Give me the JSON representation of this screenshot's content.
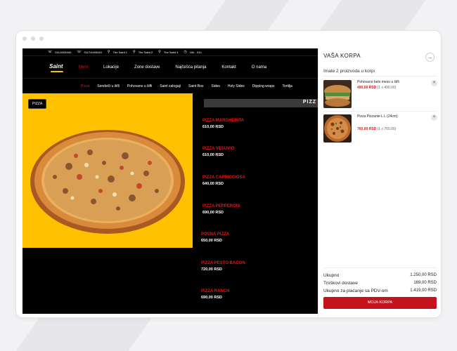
{
  "topbar": {
    "phone1": "011/4405440",
    "phone2": "0117/4405440",
    "loc1": "The Saint 1",
    "loc2": "The Saint 2",
    "loc3": "The Saint 3",
    "hours": "10h - 01h"
  },
  "logo": "Saint",
  "nav": [
    "Meni",
    "Lokacije",
    "Zone dostave",
    "Najčešća pitanja",
    "Kontakt",
    "O nama"
  ],
  "categories": [
    "Pizza",
    "Sendviči u šifli",
    "Pohovano u šifli",
    "Saint zalogaji",
    "Saint Box",
    "Sides",
    "Holy Sides",
    "Dipping wraps",
    "Tortilja"
  ],
  "hero": {
    "tag": "PIZZA"
  },
  "banner": "PIZZ",
  "menu_items": [
    {
      "name": "PIZZA MARGHERITA",
      "price": "610,00 RSD"
    },
    {
      "name": "PIZZA VESUVIO",
      "price": "610,00 RSD"
    },
    {
      "name": "PIZZA CAPRICCIOSA",
      "price": "640,00 RSD"
    },
    {
      "name": "PIZZA PEPPERONI",
      "price": "690,00 RSD"
    },
    {
      "name": "POSNA PIZZA",
      "price": "650,00 RSD"
    },
    {
      "name": "PIZZA PESTO BACON",
      "price": "720,00 RSD"
    },
    {
      "name": "PIZZA RANCH",
      "price": "690,00 RSD"
    }
  ],
  "cart": {
    "title": "VAŠA KORPA",
    "count_text": "Imate 2 proizvoda u korpi",
    "items": [
      {
        "name": "Pohovano belo meso u šifli",
        "price": "490,00 RSD",
        "qty": "(1 x 490,00)"
      },
      {
        "name": "Pizza Pizzante L L (24cm)",
        "price": "760,00 RSD",
        "qty": "(1 x 760,00)"
      }
    ],
    "totals": [
      {
        "label": "Ukupno",
        "value": "1.250,00 RSD"
      },
      {
        "label": "Troškovi dostave",
        "value": "169,00 RSD"
      },
      {
        "label": "Ukupno za plaćanje sa PDV-om",
        "value": "1.419,00 RSD"
      }
    ],
    "checkout_label": "MOJA KORPA"
  },
  "colors": {
    "accent": "#e0181b",
    "hero_bg": "#ffc000",
    "checkout": "#c4131a"
  }
}
